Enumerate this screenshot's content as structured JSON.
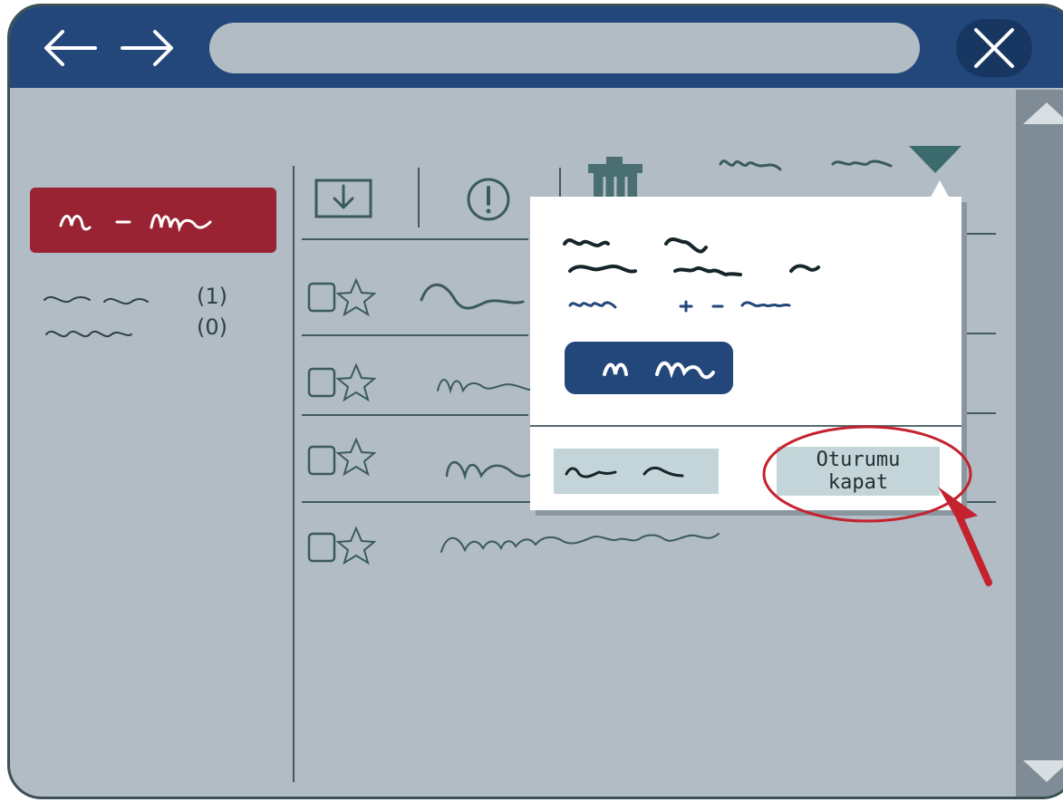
{
  "browser": {
    "back_icon": "arrow-left-icon",
    "forward_icon": "arrow-right-icon",
    "close_icon": "close-x-icon",
    "address_value": ""
  },
  "mail": {
    "folders": [
      {
        "count": "(1)"
      },
      {
        "count": "(0)"
      }
    ],
    "toolbar_icons": [
      "download-icon",
      "alert-icon",
      "trash-icon"
    ],
    "rows": 4
  },
  "account_menu": {
    "logout_label": "Oturumu kapat"
  },
  "colors": {
    "titlebar": "#23467b",
    "compose_button": "#992333",
    "highlight": "#c4222f",
    "window_bg": "#b1bcc4"
  }
}
